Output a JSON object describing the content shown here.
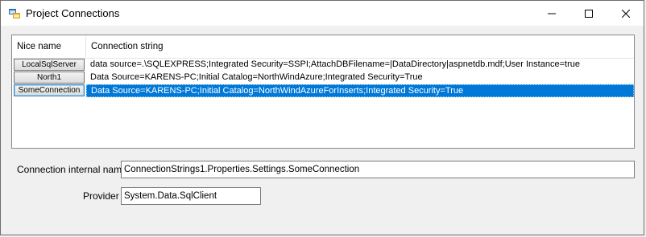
{
  "window": {
    "title": "Project Connections",
    "icon": "app-window-icon",
    "controls": {
      "minimize": "minimize-icon",
      "maximize": "maximize-icon",
      "close": "close-icon"
    }
  },
  "grid": {
    "columns": [
      "Nice name",
      "Connection string"
    ],
    "rows": [
      {
        "name": "LocalSqlServer",
        "connection": "data source=.\\SQLEXPRESS;Integrated Security=SSPI;AttachDBFilename=|DataDirectory|aspnetdb.mdf;User Instance=true",
        "selected": false
      },
      {
        "name": "North1",
        "connection": "Data Source=KARENS-PC;Initial Catalog=NorthWindAzure;Integrated Security=True",
        "selected": false
      },
      {
        "name": "SomeConnection",
        "connection": "Data Source=KARENS-PC;Initial Catalog=NorthWindAzureForInserts;Integrated Security=True",
        "selected": true
      }
    ]
  },
  "form": {
    "internal_name_label": "Connection internal name",
    "internal_name_value": "ConnectionStrings1.Properties.Settings.SomeConnection",
    "provider_label": "Provider",
    "provider_value": "System.Data.SqlClient"
  },
  "colors": {
    "selection": "#0078d7",
    "border": "#828790"
  }
}
